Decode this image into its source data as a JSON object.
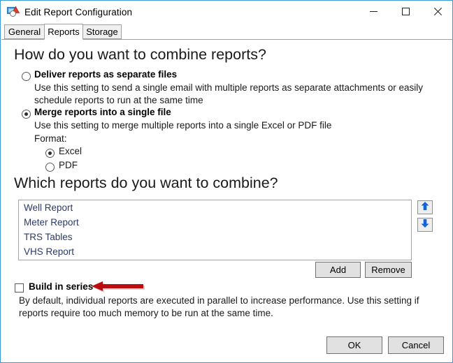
{
  "window": {
    "title": "Edit Report Configuration",
    "icon": "report-config-icon",
    "controls": {
      "minimize": "minimize-icon",
      "maximize": "maximize-icon",
      "close": "close-icon"
    }
  },
  "tabs": [
    {
      "label": "General",
      "active": false
    },
    {
      "label": "Reports",
      "active": true
    },
    {
      "label": "Storage",
      "active": false
    }
  ],
  "combine_section": {
    "heading": "How do you want to combine reports?",
    "options": [
      {
        "label": "Deliver reports as separate files",
        "description": "Use this setting to send a single email with multiple reports as separate attachments or easily schedule reports to run at the same time",
        "selected": false
      },
      {
        "label": "Merge reports into a single file",
        "description": "Use this setting to merge multiple reports into a single Excel or PDF file",
        "selected": true
      }
    ],
    "format_label": "Format:",
    "format_options": [
      {
        "label": "Excel",
        "selected": true
      },
      {
        "label": "PDF",
        "selected": false
      }
    ]
  },
  "reports_section": {
    "heading": "Which reports do you want to combine?",
    "items": [
      "Well Report",
      "Meter Report",
      "TRS Tables",
      "VHS Report"
    ],
    "move_up": "up-arrow-icon",
    "move_down": "down-arrow-icon",
    "add_label": "Add",
    "remove_label": "Remove"
  },
  "build_in_series": {
    "label": "Build in series",
    "checked": false,
    "description": "By default, individual reports are executed in parallel to increase performance.  Use this setting if reports require too much memory to be run at the same time."
  },
  "annotation": {
    "name": "red-callout-arrow",
    "color": "#bb0d0d",
    "direction": "left"
  },
  "footer": {
    "ok_label": "OK",
    "cancel_label": "Cancel"
  },
  "colors": {
    "window_border": "#3a9bd5",
    "list_text": "#2b3a67",
    "arrow_blue": "#1e6fd9",
    "button_face": "#e1e1e1"
  }
}
